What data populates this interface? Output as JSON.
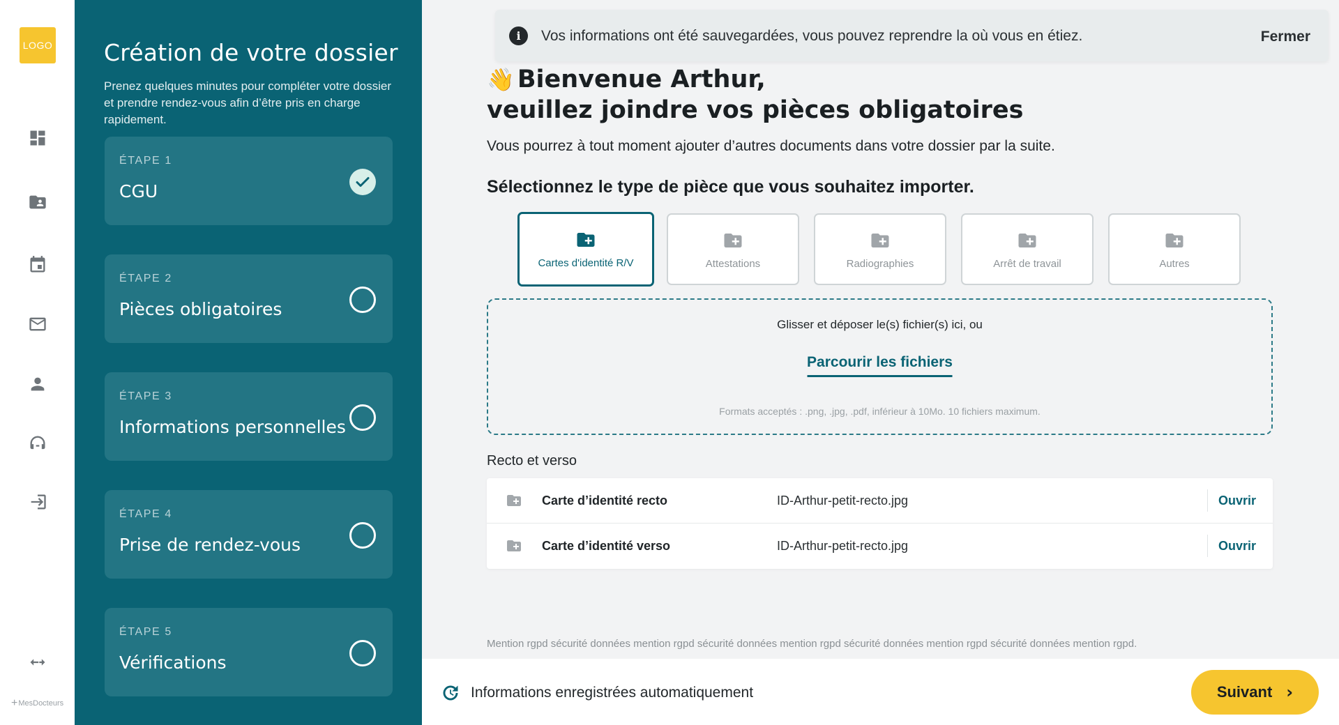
{
  "rail": {
    "logo_text": "LOGO",
    "brand": "MesDocteurs",
    "icons": [
      "dashboard-icon",
      "folder-user-icon",
      "calendar-icon",
      "mail-icon",
      "person-icon",
      "support-icon",
      "login-icon",
      "collapse-icon"
    ]
  },
  "steps_panel": {
    "title": "Création de votre dossier",
    "description": "Prenez quelques minutes pour compléter votre dossier et prendre rendez-vous afin d’être pris en charge rapidement.",
    "steps": [
      {
        "number": "ÉTAPE 1",
        "label": "CGU",
        "status": "done"
      },
      {
        "number": "ÉTAPE 2",
        "label": "Pièces obligatoires",
        "status": "todo"
      },
      {
        "number": "ÉTAPE 3",
        "label": "Informations personnelles",
        "status": "todo"
      },
      {
        "number": "ÉTAPE 4",
        "label": "Prise de rendez-vous",
        "status": "todo"
      },
      {
        "number": "ÉTAPE 5",
        "label": "Vérifications",
        "status": "todo"
      }
    ]
  },
  "notice": {
    "text": "Vos informations ont été sauvegardées, vous pouvez reprendre la où vous en étiez.",
    "close_label": "Fermer"
  },
  "welcome": {
    "emoji": "👋",
    "line1": "Bienvenue Arthur,",
    "line2": "veuillez joindre vos pièces obligatoires",
    "subtext": "Vous pourrez à tout moment ajouter d’autres documents dans votre dossier par la suite.",
    "select_title": "Sélectionnez le type de pièce que vous souhaitez importer."
  },
  "doc_types": [
    {
      "label": "Cartes d'identité R/V",
      "active": true
    },
    {
      "label": "Attestations",
      "active": false
    },
    {
      "label": "Radiographies",
      "active": false
    },
    {
      "label": "Arrêt de travail",
      "active": false
    },
    {
      "label": "Autres",
      "active": false
    }
  ],
  "dropzone": {
    "text": "Glisser et déposer le(s) fichier(s) ici, ou",
    "browse_label": "Parcourir les fichiers",
    "formats": "Formats acceptés : .png, .jpg, .pdf, inférieur à 10Mo. 10 fichiers maximum."
  },
  "files": {
    "title": "Recto et verso",
    "rows": [
      {
        "name": "Carte d’identité recto",
        "path": "ID-Arthur-petit-recto.jpg",
        "action": "Ouvrir"
      },
      {
        "name": "Carte d’identité verso",
        "path": "ID-Arthur-petit-recto.jpg",
        "action": "Ouvrir"
      }
    ]
  },
  "rgpd": "Mention rgpd sécurité données mention rgpd sécurité données mention rgpd sécurité données mention rgpd sécurité données mention rgpd.",
  "footer": {
    "autosave_text": "Informations enregistrées automatiquement",
    "next_label": "Suivant"
  },
  "colors": {
    "primary": "#0a6374",
    "accent": "#f6c52f",
    "card": "#237584"
  }
}
